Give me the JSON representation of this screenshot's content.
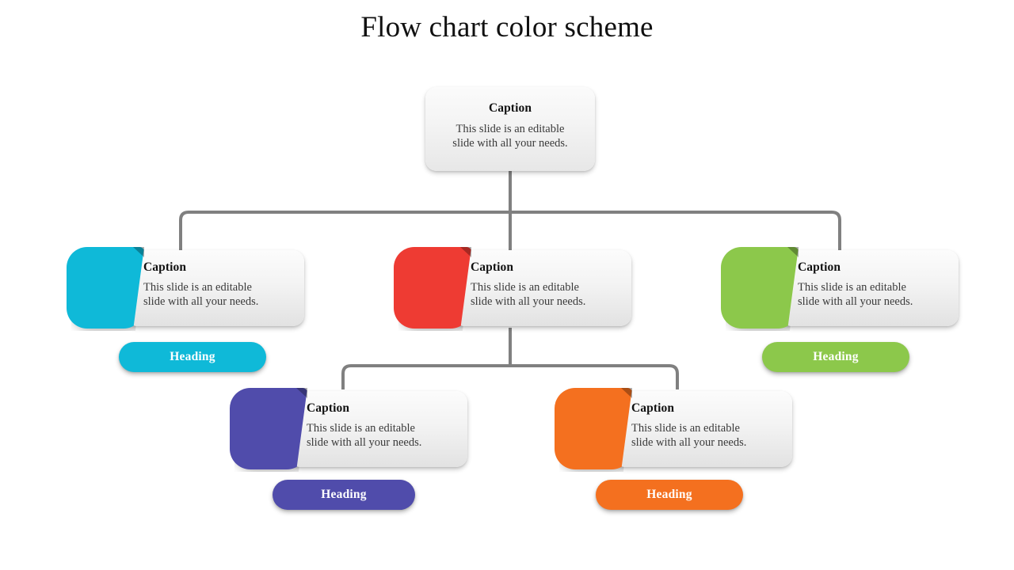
{
  "slide": {
    "title": "Flow chart color scheme",
    "background": "#ffffff",
    "connector_color": "#808080"
  },
  "root": {
    "caption": "Caption",
    "body_line1": "This slide is an editable",
    "body_line2": "slide with all your needs."
  },
  "nodes": [
    {
      "id": "cyan",
      "caption": "Caption",
      "body_line1": "This slide is an editable",
      "body_line2": "slide with all your needs.",
      "heading": "Heading",
      "color": "#0FB9D8",
      "has_heading_pill": true
    },
    {
      "id": "red",
      "caption": "Caption",
      "body_line1": "This slide is an editable",
      "body_line2": "slide with all your needs.",
      "heading": "",
      "color": "#EE3B33",
      "has_heading_pill": false
    },
    {
      "id": "green",
      "caption": "Caption",
      "body_line1": "This slide is an editable",
      "body_line2": "slide with all your needs.",
      "heading": "Heading",
      "color": "#8CC84B",
      "has_heading_pill": true
    },
    {
      "id": "purple",
      "caption": "Caption",
      "body_line1": "This slide is an editable",
      "body_line2": "slide with all your needs.",
      "heading": "Heading",
      "color": "#504CAB",
      "has_heading_pill": true
    },
    {
      "id": "orange",
      "caption": "Caption",
      "body_line1": "This slide is an editable",
      "body_line2": "slide with all your needs.",
      "heading": "Heading",
      "color": "#F4701F",
      "has_heading_pill": true
    }
  ],
  "chart_data": {
    "type": "diagram",
    "diagram_type": "flowchart-tree",
    "title": "Flow chart color scheme",
    "levels": 3,
    "nodes": [
      {
        "id": "root",
        "level": 0,
        "caption": "Caption",
        "text": "This slide is an editable slide with all your needs.",
        "color": "#efefef",
        "heading": null
      },
      {
        "id": "cyan",
        "level": 1,
        "caption": "Caption",
        "text": "This slide is an editable slide with all your needs.",
        "color": "#0FB9D8",
        "heading": "Heading"
      },
      {
        "id": "red",
        "level": 1,
        "caption": "Caption",
        "text": "This slide is an editable slide with all your needs.",
        "color": "#EE3B33",
        "heading": null
      },
      {
        "id": "green",
        "level": 1,
        "caption": "Caption",
        "text": "This slide is an editable slide with all your needs.",
        "color": "#8CC84B",
        "heading": "Heading"
      },
      {
        "id": "purple",
        "level": 2,
        "caption": "Caption",
        "text": "This slide is an editable slide with all your needs.",
        "color": "#504CAB",
        "heading": "Heading"
      },
      {
        "id": "orange",
        "level": 2,
        "caption": "Caption",
        "text": "This slide is an editable slide with all your needs.",
        "color": "#F4701F",
        "heading": "Heading"
      }
    ],
    "edges": [
      {
        "from": "root",
        "to": "cyan"
      },
      {
        "from": "root",
        "to": "red"
      },
      {
        "from": "root",
        "to": "green"
      },
      {
        "from": "red",
        "to": "purple"
      },
      {
        "from": "red",
        "to": "orange"
      }
    ]
  }
}
